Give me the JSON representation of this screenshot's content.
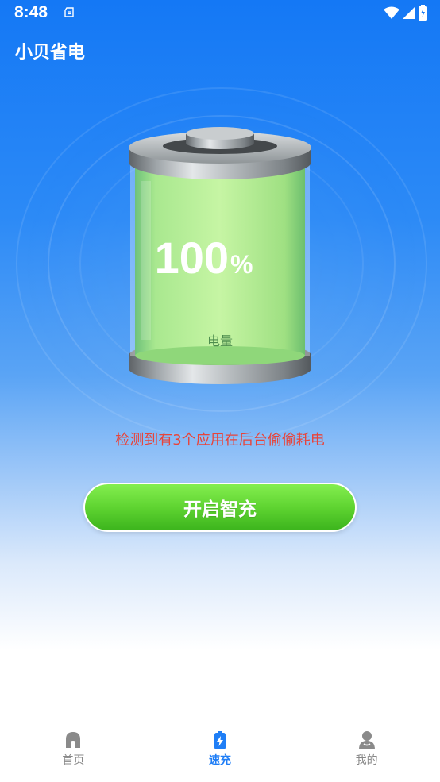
{
  "status_bar": {
    "time": "8:48"
  },
  "app": {
    "title": "小贝省电"
  },
  "battery": {
    "percent_value": "100",
    "percent_sign": "%",
    "label": "电量",
    "level": 1.0
  },
  "info": {
    "warning": "检测到有3个应用在后台偷偷耗电"
  },
  "actions": {
    "smart_charge_label": "开启智充"
  },
  "nav": {
    "items": [
      {
        "label": "首页",
        "icon": "home-icon"
      },
      {
        "label": "速充",
        "icon": "battery-charge-icon",
        "active": true
      },
      {
        "label": "我的",
        "icon": "profile-icon"
      }
    ]
  },
  "colors": {
    "accent": "#1f7ef6",
    "warning": "#e8443a",
    "button": "#5fd431"
  }
}
